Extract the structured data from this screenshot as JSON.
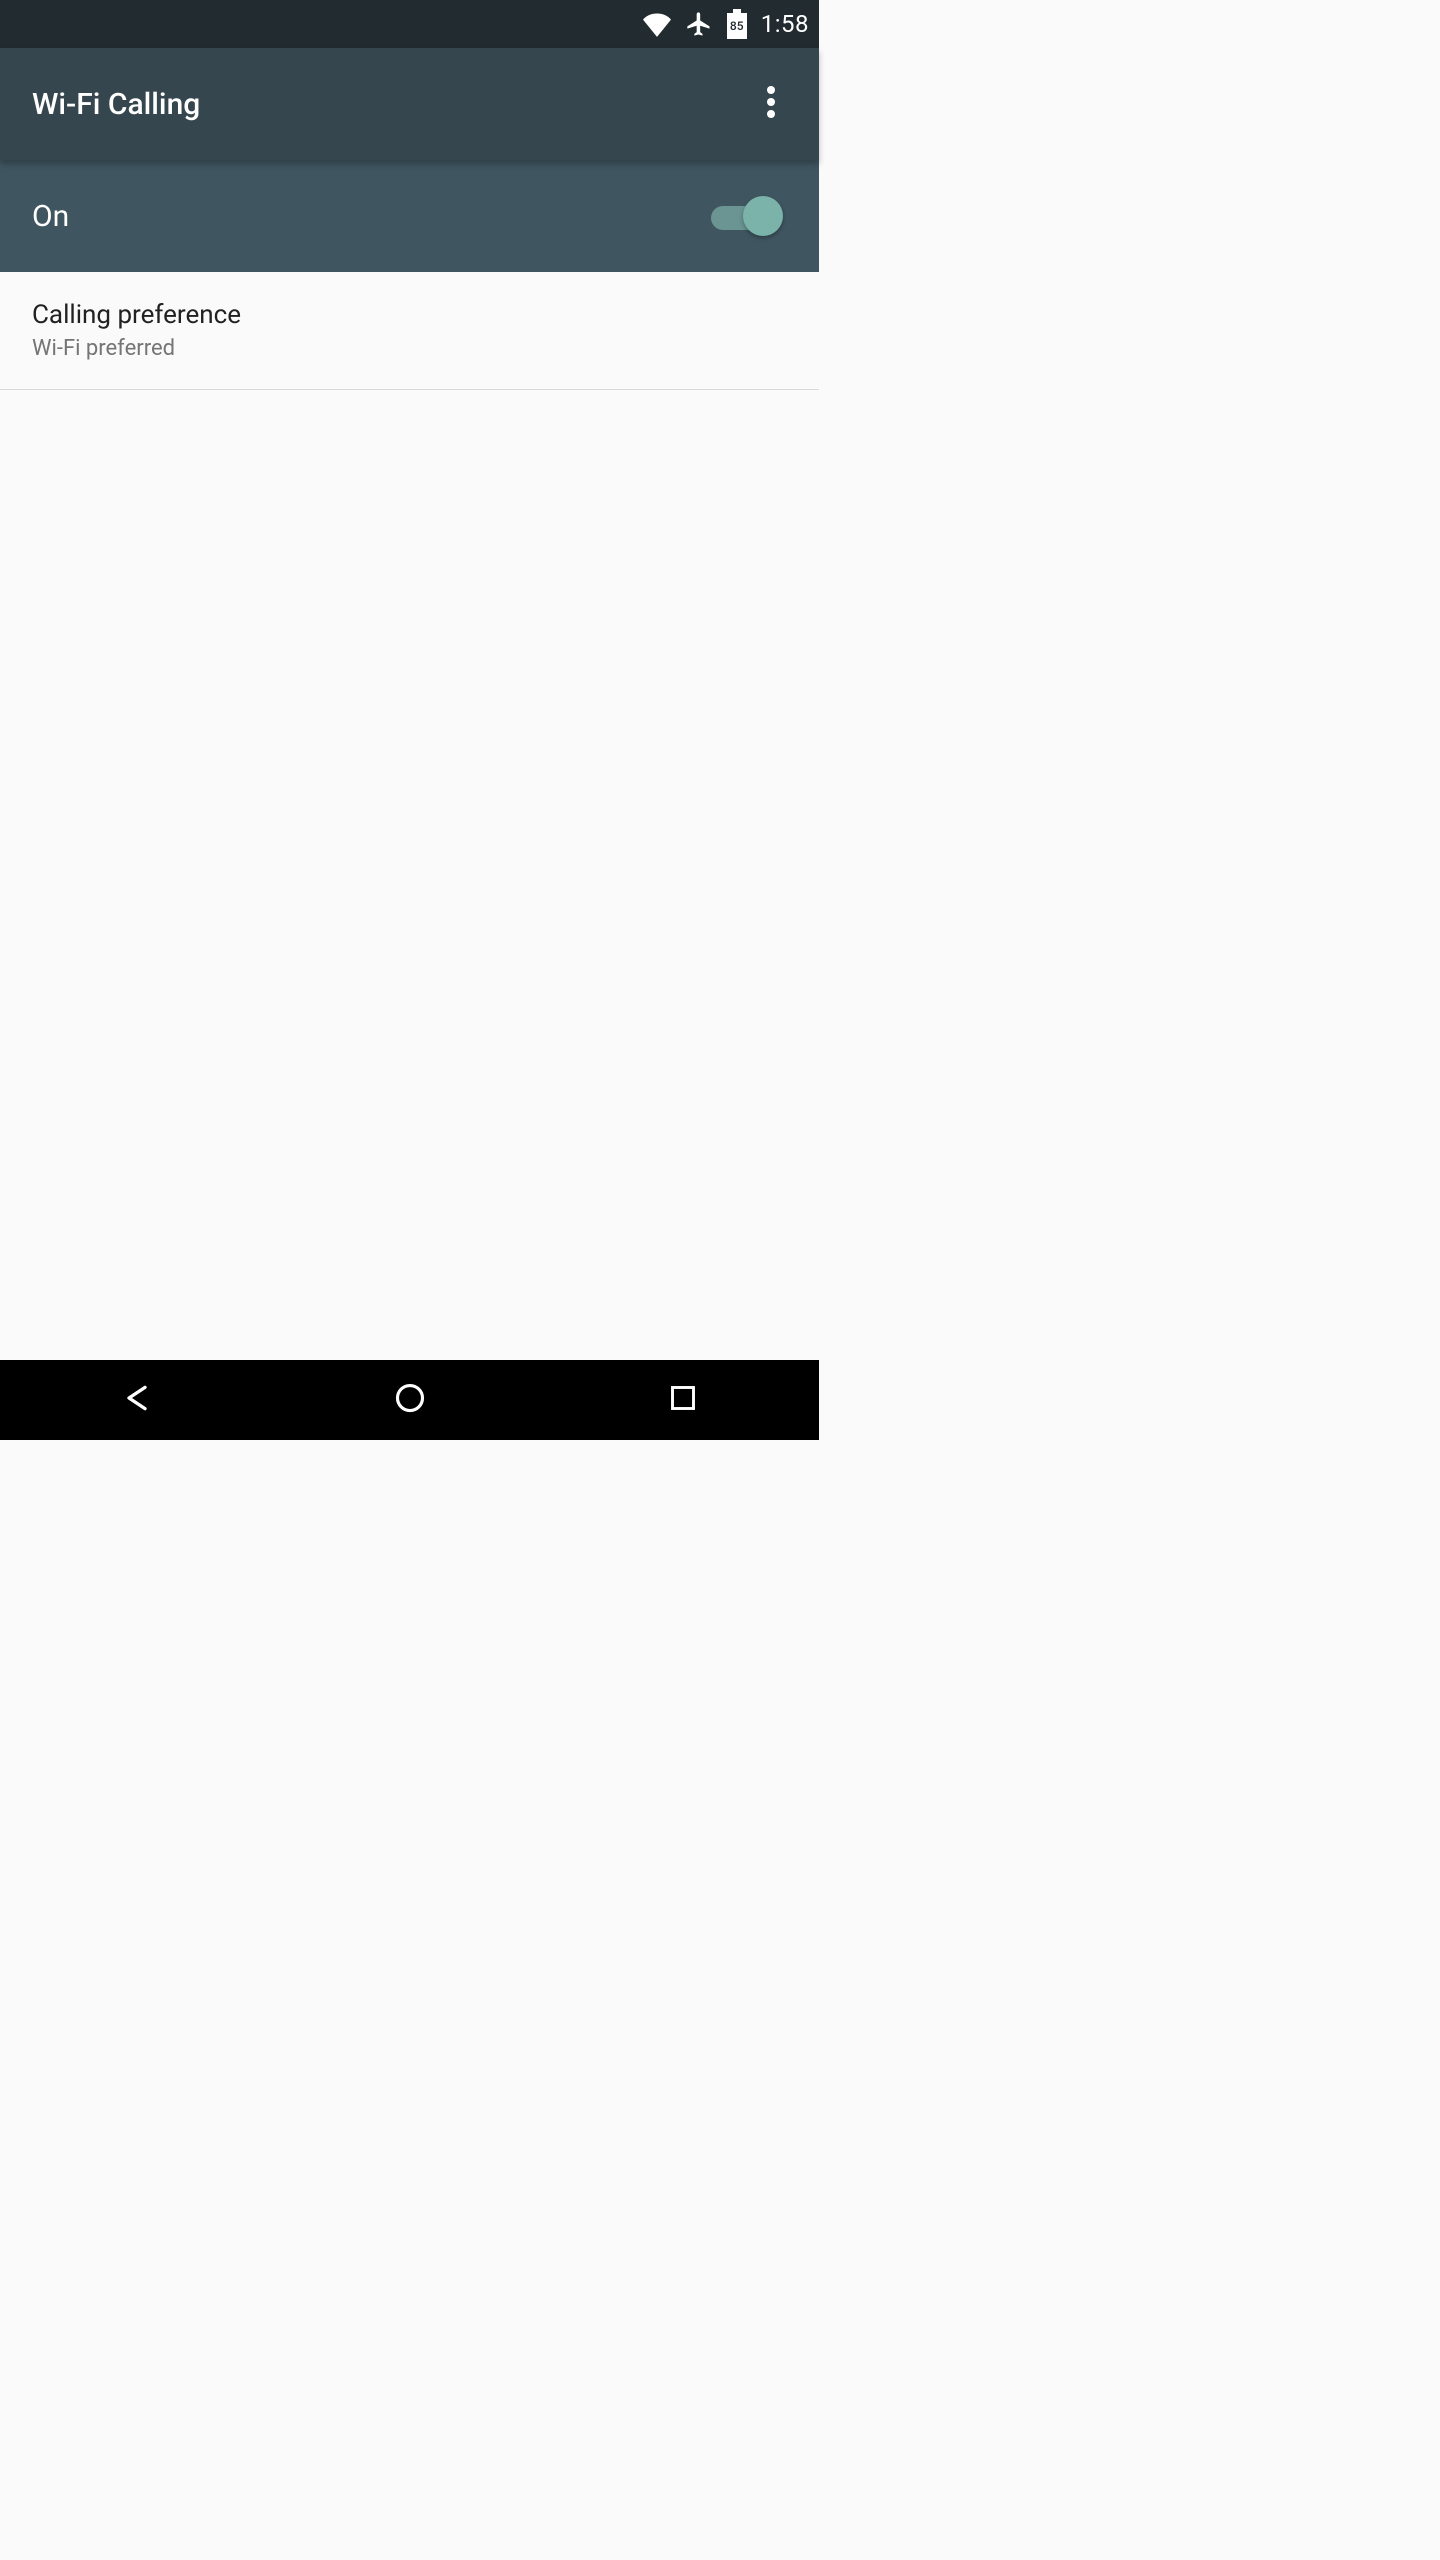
{
  "status_bar": {
    "battery_level": "85",
    "time": "1:58"
  },
  "app_bar": {
    "title": "Wi-Fi Calling"
  },
  "toggle": {
    "label": "On",
    "on": true
  },
  "settings": {
    "calling_preference": {
      "title": "Calling preference",
      "value": "Wi-Fi preferred"
    }
  },
  "colors": {
    "status_bar_bg": "#212b30",
    "app_bar_bg": "#35464f",
    "toggle_row_bg": "#3f5560",
    "accent": "#7bb3ab"
  }
}
